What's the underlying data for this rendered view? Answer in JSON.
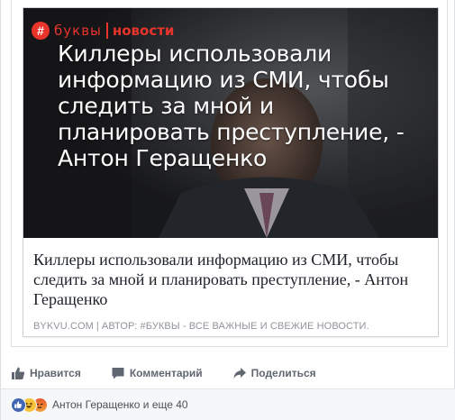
{
  "card": {
    "brand_symbol": "#",
    "brand_name": "буквы",
    "brand_section": "новости",
    "hero_headline": "Киллеры использовали информацию из СМИ, чтобы следить за мной и планировать преступление, - Антон Геращенко",
    "title": "Киллеры использовали информацию из СМИ, чтобы следить за мной и планировать преступление, - Антон Геращенко",
    "domain": "BYKVU.COM",
    "separator": "|",
    "author": "АВТОР: #БУКВЫ - ВСЕ ВАЖНЫЕ И СВЕЖИЕ НОВОСТИ."
  },
  "actions": {
    "like_label": "Нравится",
    "comment_label": "Комментарий",
    "share_label": "Поделиться"
  },
  "reactions": {
    "summary": "Антон Геращенко и еще 40",
    "icons": [
      "like-icon",
      "haha-icon",
      "angry-icon"
    ]
  },
  "colors": {
    "brand_red": "#e8342b",
    "facebook_blue": "#4267b2",
    "meta_gray": "#90949c",
    "action_gray": "#606770"
  }
}
